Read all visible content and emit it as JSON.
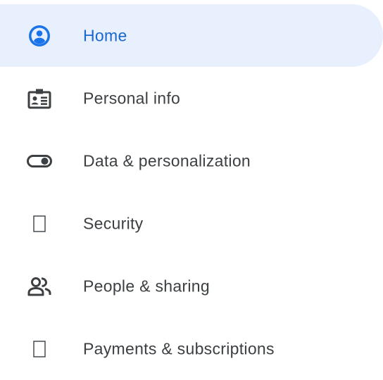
{
  "nav": {
    "items": [
      {
        "label": "Home",
        "icon": "account-circle-icon",
        "active": true
      },
      {
        "label": "Personal info",
        "icon": "id-card-icon",
        "active": false
      },
      {
        "label": "Data & personalization",
        "icon": "toggle-icon",
        "active": false
      },
      {
        "label": "Security",
        "icon": "missing-image-icon",
        "active": false
      },
      {
        "label": "People & sharing",
        "icon": "people-icon",
        "active": false
      },
      {
        "label": "Payments & subscriptions",
        "icon": "missing-image-icon",
        "active": false
      }
    ]
  },
  "colors": {
    "active_bg": "#e8f0fe",
    "active_text": "#1967d2",
    "text": "#3c4043",
    "icon": "#3c4043"
  }
}
